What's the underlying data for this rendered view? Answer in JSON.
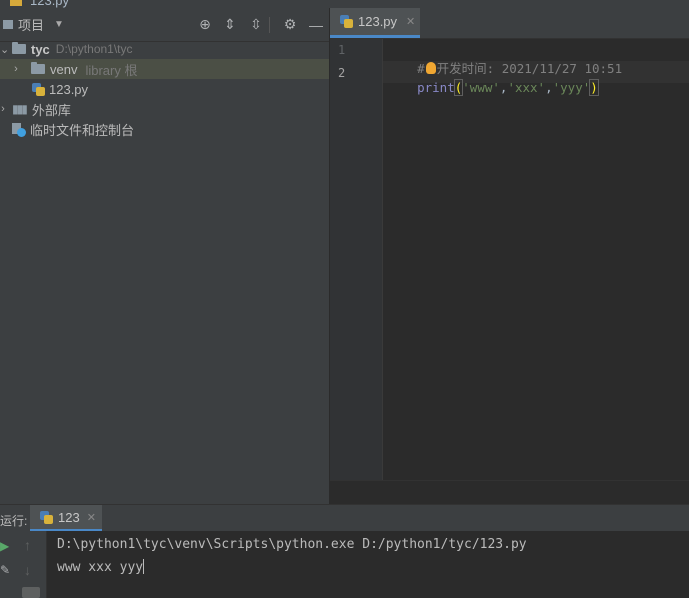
{
  "window": {
    "title": "123.py"
  },
  "project_panel": {
    "title": "项目",
    "tree": [
      {
        "name": "tyc",
        "path": "D:\\python1\\tyc"
      },
      {
        "name": "venv",
        "note": "library 根"
      },
      {
        "name": "123.py"
      },
      {
        "name": "外部库"
      },
      {
        "name": "临时文件和控制台"
      }
    ]
  },
  "editor": {
    "tab_label": "123.py",
    "line_numbers": [
      "1",
      "2"
    ],
    "lines": {
      "comment": "#",
      "comment_rest": "开发时间: 2021/11/27 10:51",
      "print_kw": "print",
      "open_paren": "(",
      "arg1": "'www'",
      "comma1": ",",
      "arg2": "'xxx'",
      "comma2": ",",
      "arg3": "'yyy'",
      "close_paren": ")"
    }
  },
  "run_panel": {
    "label": "运行:",
    "tab_label": "123",
    "console": [
      "D:\\python1\\tyc\\venv\\Scripts\\python.exe D:/python1/tyc/123.py",
      "www xxx yyy"
    ]
  },
  "colors": {
    "accent": "#4a88c7",
    "keyword": "#8888c6",
    "string": "#6a8759",
    "comment": "#808080"
  }
}
